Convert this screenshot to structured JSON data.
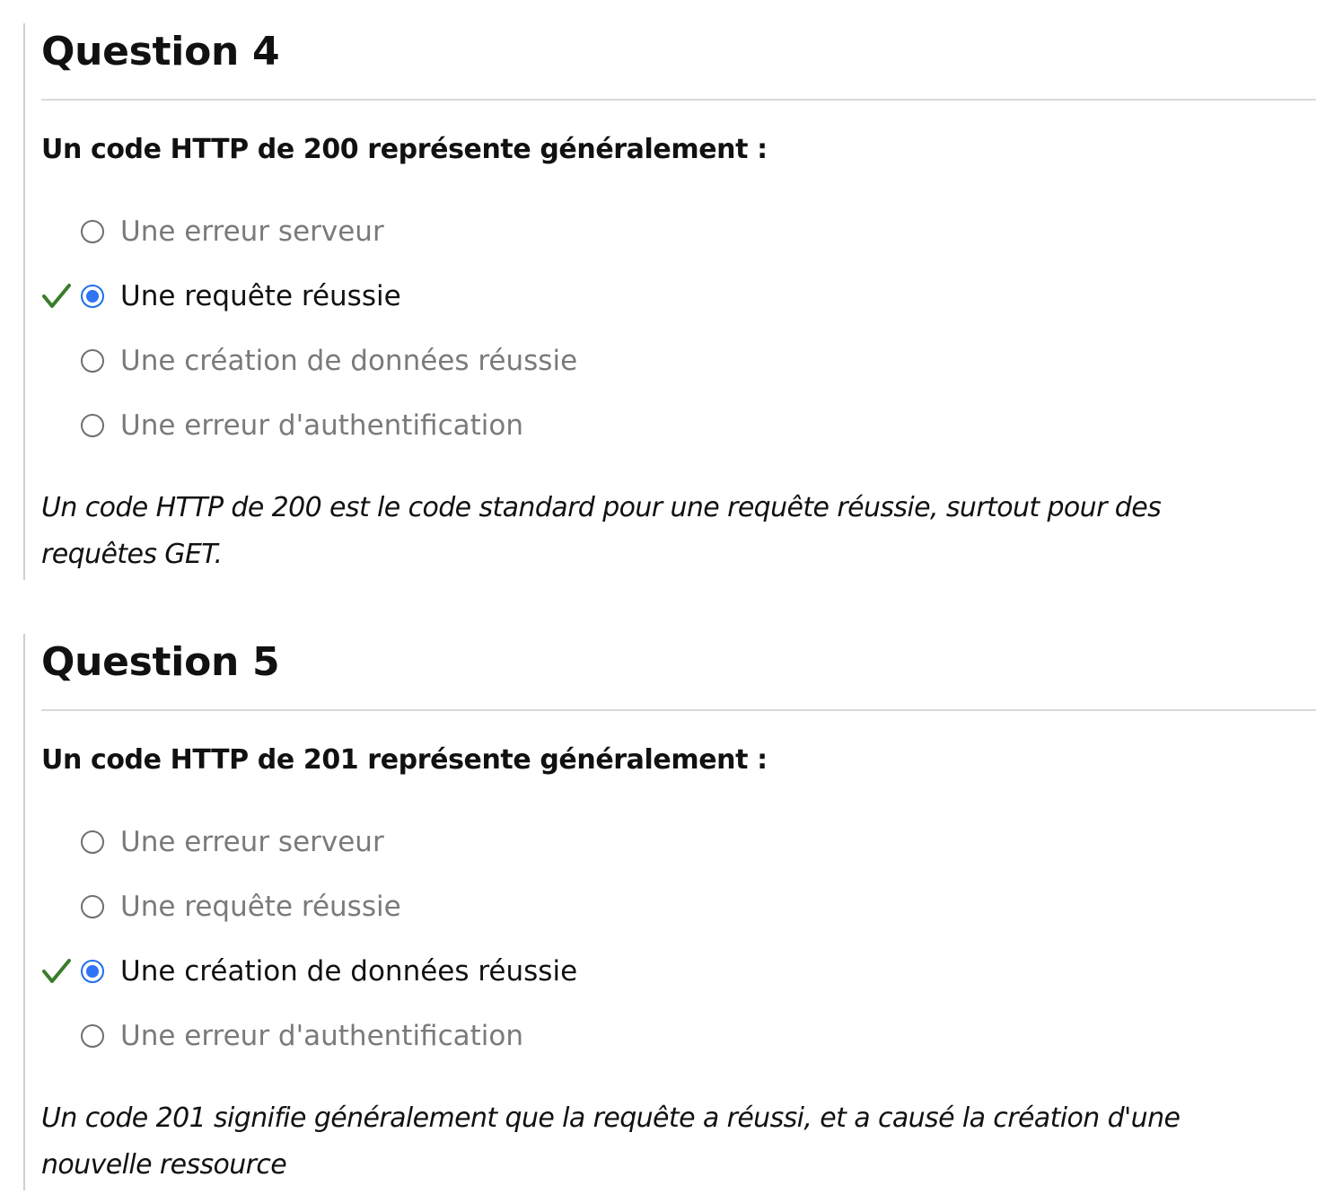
{
  "questions": [
    {
      "title": "Question 4",
      "prompt": "Un code HTTP de 200 représente généralement :",
      "answers": [
        {
          "label": "Une erreur serveur",
          "selected": false,
          "correct": false
        },
        {
          "label": "Une requête réussie",
          "selected": true,
          "correct": true
        },
        {
          "label": "Une création de données réussie",
          "selected": false,
          "correct": false
        },
        {
          "label": "Une erreur d'authentification",
          "selected": false,
          "correct": false
        }
      ],
      "explanation_line1": "Un code HTTP de 200 est le code standard pour une requête réussie, surtout pour des",
      "explanation_line2": "requêtes GET."
    },
    {
      "title": "Question 5",
      "prompt": "Un code HTTP de 201 représente généralement :",
      "answers": [
        {
          "label": "Une erreur serveur",
          "selected": false,
          "correct": false
        },
        {
          "label": "Une requête réussie",
          "selected": false,
          "correct": false
        },
        {
          "label": "Une création de données réussie",
          "selected": true,
          "correct": true
        },
        {
          "label": "Une erreur d'authentification",
          "selected": false,
          "correct": false
        }
      ],
      "explanation_line1": "Un code 201 signifie généralement que la requête a réussi, et a causé la création d'une",
      "explanation_line2": "nouvelle ressource"
    }
  ],
  "icons": {
    "correct": "check-icon",
    "radio_selected": "radio-selected-icon",
    "radio_unselected": "radio-unselected-icon"
  },
  "colors": {
    "correct_check": "#3a7d2c",
    "radio_selected": "#2f74f5",
    "label_unselected": "#7a7a7a",
    "label_selected": "#111111",
    "block_border": "#cfcfcf",
    "rule": "#d9d9d9"
  }
}
